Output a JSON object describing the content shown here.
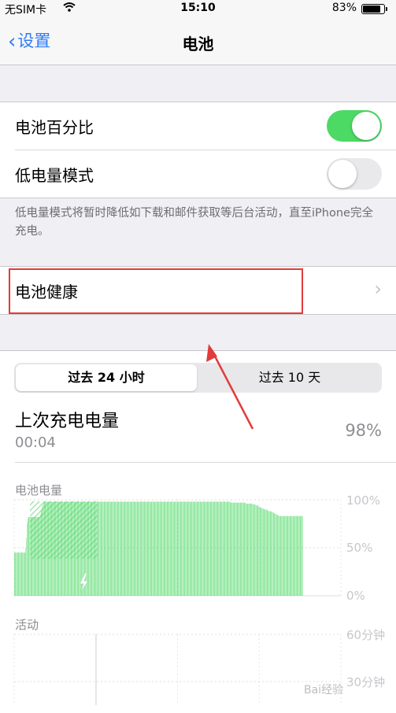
{
  "status": {
    "carrier": "无SIM卡",
    "time": "15:10",
    "battery": "83%",
    "battery_level": 0.83
  },
  "nav": {
    "back_label": "设置",
    "title": "电池"
  },
  "settings": {
    "battery_percentage": {
      "label": "电池百分比",
      "on": true
    },
    "low_power_mode": {
      "label": "低电量模式",
      "on": false
    },
    "footnote": "低电量模式将暂时降低如下载和邮件获取等后台活动，直至iPhone完全充电。",
    "battery_health": {
      "label": "电池健康"
    }
  },
  "segment": {
    "options": [
      "过去 24 小时",
      "过去 10 天"
    ],
    "selected": 0
  },
  "last_charge": {
    "title": "上次充电电量",
    "time": "00:04",
    "percent": "98%"
  },
  "battery_chart_label": "电池电量",
  "activity_chart_label": "活动",
  "colors": {
    "accent": "#2f7cf6",
    "toggle_on": "#4cd964",
    "bar": "#4cd964",
    "highlight": "#e23b3b"
  },
  "chart_data": [
    {
      "type": "bar",
      "ylabel": "电池电量",
      "yticks": [
        "100%",
        "50%",
        "0%"
      ],
      "ylim": [
        0,
        100
      ],
      "values": [
        45,
        45,
        45,
        45,
        45,
        45,
        45,
        45,
        45,
        45,
        45,
        45,
        45,
        45,
        45,
        45,
        45,
        45,
        50,
        60,
        75,
        80,
        82,
        82,
        82,
        82,
        82,
        82,
        82,
        82,
        82,
        82,
        82,
        82,
        82,
        82,
        82,
        82,
        82,
        82,
        83,
        85,
        88,
        90,
        93,
        95,
        97,
        98,
        98,
        98,
        98,
        98,
        98,
        98,
        98,
        98,
        98,
        98,
        98,
        98,
        98,
        98,
        98,
        98,
        98,
        98,
        98,
        98,
        98,
        98,
        98,
        98,
        98,
        98,
        98,
        98,
        98,
        98,
        98,
        98,
        98,
        98,
        98,
        98,
        98,
        98,
        98,
        98,
        98,
        98,
        98,
        98,
        98,
        98,
        98,
        98,
        98,
        98,
        98,
        98,
        98,
        98,
        98,
        98,
        98,
        98,
        98,
        98,
        98,
        98,
        98,
        98,
        98,
        98,
        98,
        98,
        98,
        98,
        98,
        98,
        98,
        98,
        98,
        98,
        98,
        98,
        98,
        98,
        98,
        98,
        98,
        98,
        98,
        98,
        98,
        98,
        98,
        98,
        98,
        98,
        98,
        98,
        98,
        98,
        98,
        98,
        98,
        98,
        98,
        98,
        98,
        98,
        98,
        98,
        98,
        98,
        98,
        98,
        98,
        98,
        98,
        98,
        98,
        98,
        98,
        98,
        98,
        98,
        98,
        98,
        98,
        98,
        98,
        98,
        98,
        98,
        98,
        98,
        98,
        98,
        98,
        98,
        98,
        98,
        98,
        98,
        98,
        98,
        98,
        98,
        98,
        98,
        98,
        98,
        98,
        98,
        98,
        98,
        98,
        98,
        98,
        98,
        98,
        98,
        98,
        98,
        98,
        98,
        98,
        98,
        98,
        98,
        98,
        98,
        98,
        98,
        98,
        98,
        98,
        98,
        98,
        98,
        98,
        98,
        98,
        98,
        98,
        98,
        98,
        98,
        98,
        98,
        98,
        98,
        98,
        98,
        98,
        98,
        98,
        98,
        98,
        98,
        98,
        98,
        98,
        98,
        98,
        98,
        98,
        98,
        98,
        98,
        98,
        98,
        98,
        98,
        98,
        98,
        98,
        98,
        98,
        98,
        98,
        98,
        98,
        98,
        98,
        98,
        98,
        98,
        98,
        98,
        98,
        98,
        98,
        98,
        98,
        98,
        98,
        98,
        98,
        98,
        98,
        98,
        98,
        98,
        98,
        98,
        98,
        98,
        98,
        98,
        98,
        98,
        98,
        98,
        98,
        98,
        98,
        98,
        98,
        98,
        98,
        98,
        98,
        98,
        98,
        98,
        98,
        98,
        98,
        98,
        98,
        98,
        98,
        98,
        98,
        98,
        98,
        98,
        98,
        98,
        98,
        98,
        98,
        98,
        98,
        98,
        98,
        98,
        98,
        98,
        98,
        98,
        98,
        98,
        98,
        98,
        98,
        98,
        97,
        97,
        97,
        97,
        97,
        97,
        97,
        97,
        97,
        97,
        97,
        97,
        97,
        97,
        97,
        97,
        97,
        97,
        97,
        97,
        97,
        97,
        97,
        97,
        96,
        96,
        96,
        96,
        96,
        96,
        96,
        96,
        96,
        96,
        96,
        95,
        95,
        95,
        95,
        95,
        94,
        94,
        94,
        94,
        93,
        93,
        92,
        92,
        92,
        91,
        91,
        91,
        90,
        90,
        90,
        90,
        90,
        89,
        89,
        89,
        88,
        88,
        88,
        88,
        88,
        87,
        87,
        87,
        86,
        86,
        85,
        85,
        85,
        84,
        84,
        84,
        83,
        83,
        83,
        83,
        83,
        83,
        83,
        83,
        83,
        83,
        83,
        83,
        83,
        83,
        83,
        83,
        83,
        83,
        83,
        83,
        83,
        83,
        83,
        83,
        83,
        83,
        83,
        83,
        83,
        83,
        83,
        83,
        83,
        83,
        83,
        83,
        83,
        83
      ]
    },
    {
      "type": "bar",
      "ylabel": "活动",
      "yticks": [
        "60分钟",
        "30分钟"
      ],
      "ylim": [
        0,
        60
      ]
    }
  ]
}
